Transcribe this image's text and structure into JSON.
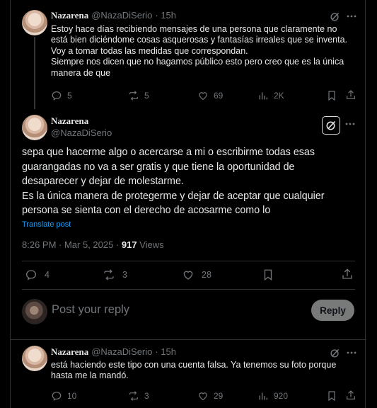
{
  "tweet1": {
    "name": "Nazarena",
    "handle": "@NazaDiSerio",
    "time": "· 15h",
    "lines": [
      "Estoy hace días recibiendo mensajes de una persona que claramente no",
      "está bien diciéndome cosas asquerosas y fantasías irreales que se inventa.",
      "Voy a tomar todas las medidas que correspondan.",
      "Siempre nos dicen que no hagamos público esto pero creo que es la única",
      "manera de que"
    ],
    "replies": "5",
    "reposts": "5",
    "likes": "69",
    "views": "2K"
  },
  "main": {
    "name": "Nazarena",
    "handle": "@NazaDiSerio",
    "lines": [
      "sepa que hacerme algo o acercarse a mi o escribirme todas esas",
      "guarangadas no va a ser gratis y que tiene la oportunidad de",
      "desaparecer y dejar de molestarme.",
      "Es la única manera de protegerme y dejar de aceptar que cualquier",
      "persona se sienta con el derecho de acosarme como lo"
    ],
    "translate": "Translate post",
    "timestamp": "8:26 PM · Mar 5, 2025 · ",
    "views_count": "917",
    "views_label": " Views",
    "replies": "4",
    "reposts": "3",
    "likes": "28"
  },
  "reply_box": {
    "placeholder": "Post your reply",
    "button": "Reply"
  },
  "tweet3": {
    "name": "Nazarena",
    "handle": "@NazaDiSerio",
    "time": "· 15h",
    "lines": [
      "está haciendo este tipo con una cuenta falsa. Ya tenemos su foto porque",
      "hasta me la mandó."
    ],
    "replies": "10",
    "reposts": "3",
    "likes": "29",
    "views": "920"
  },
  "colors": {
    "background": "#000000",
    "text": "#e7e9ea",
    "muted": "#71767b",
    "link": "#1d9bf0",
    "divider": "#2f3336"
  }
}
